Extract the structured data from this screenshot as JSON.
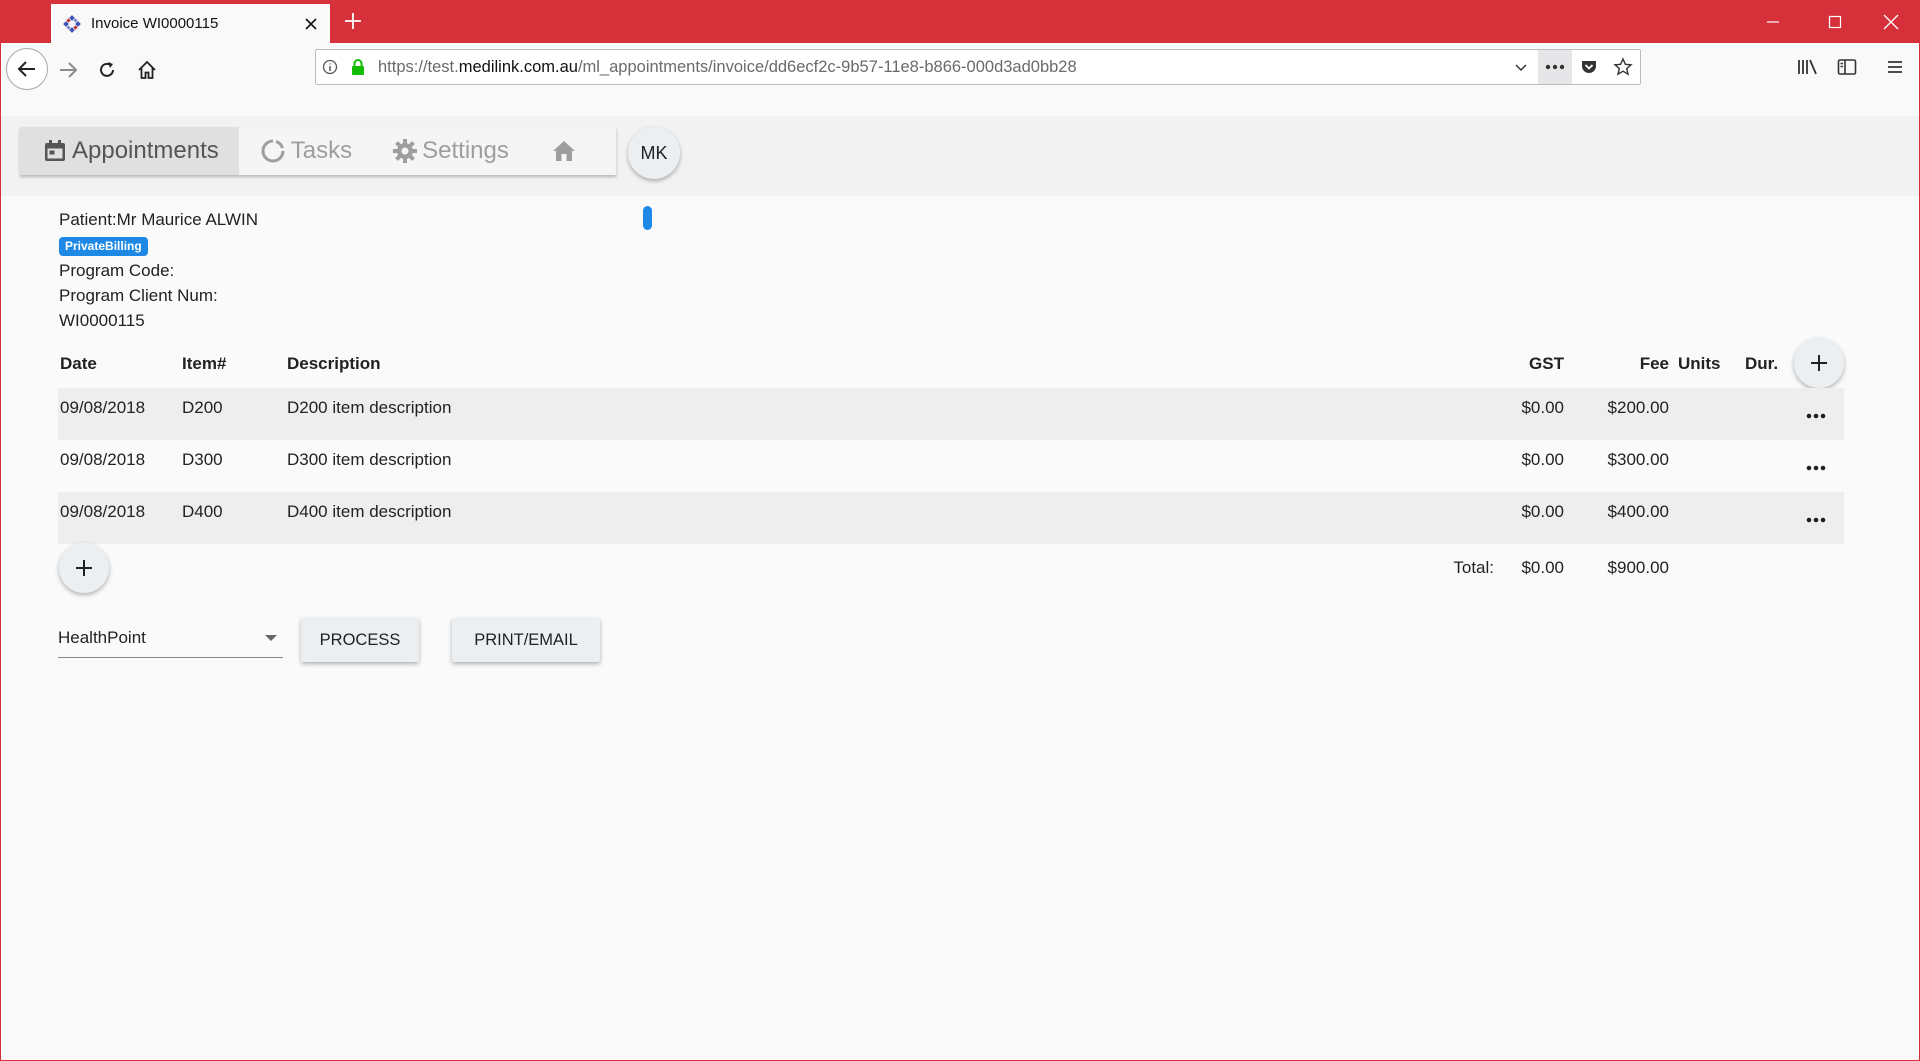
{
  "browser": {
    "tab_title": "Invoice WI0000115",
    "url_prefix": "https://test.",
    "url_domain": "medilink.com.au",
    "url_path": "/ml_appointments/invoice/dd6ecf2c-9b57-11e8-b866-000d3ad0bb28",
    "accent_color": "#d6313a"
  },
  "appnav": {
    "appointments": "Appointments",
    "tasks": "Tasks",
    "settings": "Settings",
    "avatar": "MK"
  },
  "patient": {
    "name_line": "Patient:Mr Maurice ALWIN",
    "badge": "PrivateBilling",
    "program_code": "Program Code:",
    "program_client_num": "Program Client Num:",
    "invoice_number": "WI0000115"
  },
  "table": {
    "headers": {
      "date": "Date",
      "item": "Item#",
      "description": "Description",
      "gst": "GST",
      "fee": "Fee",
      "units": "Units",
      "dur": "Dur."
    },
    "rows": [
      {
        "date": "09/08/2018",
        "item": "D200",
        "description": "D200 item description",
        "gst": "$0.00",
        "fee": "$200.00"
      },
      {
        "date": "09/08/2018",
        "item": "D300",
        "description": "D300 item description",
        "gst": "$0.00",
        "fee": "$300.00"
      },
      {
        "date": "09/08/2018",
        "item": "D400",
        "description": "D400 item description",
        "gst": "$0.00",
        "fee": "$400.00"
      }
    ],
    "totals": {
      "label": "Total:",
      "gst": "$0.00",
      "fee": "$900.00"
    }
  },
  "actions": {
    "payer_select": "HealthPoint",
    "process": "PROCESS",
    "print_email": "PRINT/EMAIL"
  }
}
